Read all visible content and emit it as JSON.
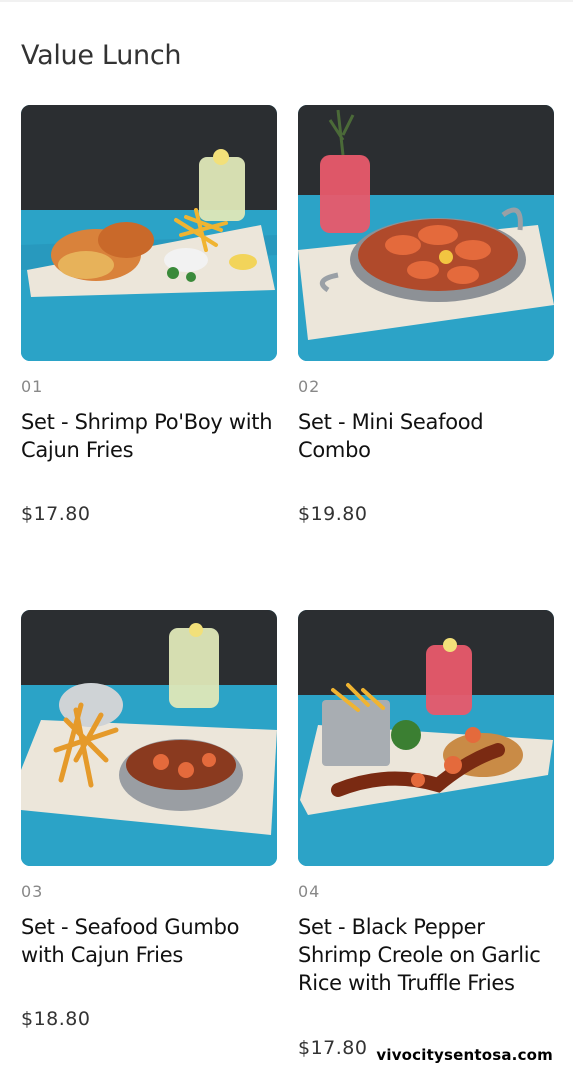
{
  "page": {
    "section_title": "Value Lunch",
    "watermark": "vivocitysentosa.com"
  },
  "items": [
    {
      "number": "01",
      "name": "Set - Shrimp Po'Boy with Cajun Fries",
      "price": "$17.80"
    },
    {
      "number": "02",
      "name": "Set - Mini Seafood Combo",
      "price": "$19.80"
    },
    {
      "number": "03",
      "name": "Set - Seafood Gumbo with Cajun Fries",
      "price": "$18.80"
    },
    {
      "number": "04",
      "name": "Set - Black Pepper Shrimp Creole on Garlic Rice with Truffle Fries",
      "price": "$17.80"
    }
  ],
  "colors": {
    "wall": "#2a2d30",
    "table": "#2ca3c7",
    "plate": "#ece6da",
    "drink_lemon": "#dfe8b8",
    "drink_pink": "#e85a6c"
  }
}
